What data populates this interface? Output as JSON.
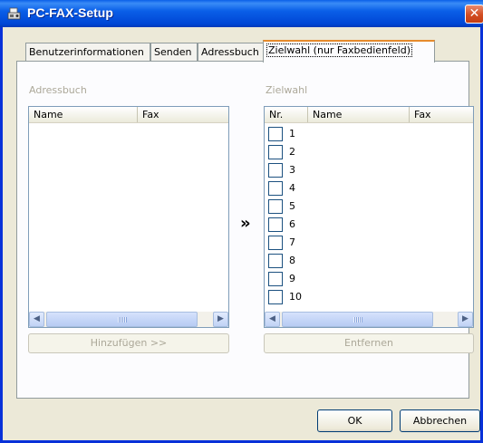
{
  "window": {
    "title": "PC-FAX-Setup",
    "close_glyph": "✕",
    "accent": "#0a5fe8",
    "close_color": "#d24d22"
  },
  "tabs": [
    {
      "label": "Benutzerinformationen",
      "active": false
    },
    {
      "label": "Senden",
      "active": false
    },
    {
      "label": "Adressbuch",
      "active": false
    },
    {
      "label": "Zielwahl (nur Faxbedienfeld)",
      "active": true
    }
  ],
  "addressbook": {
    "group_label": "Adressbuch",
    "columns": [
      "Name",
      "Fax"
    ],
    "add_button": "Hinzufügen >>"
  },
  "speeddial": {
    "group_label": "Zielwahl",
    "columns": [
      "Nr.",
      "Name",
      "Fax"
    ],
    "rows": [
      {
        "nr": "1"
      },
      {
        "nr": "2"
      },
      {
        "nr": "3"
      },
      {
        "nr": "4"
      },
      {
        "nr": "5"
      },
      {
        "nr": "6"
      },
      {
        "nr": "7"
      },
      {
        "nr": "8"
      },
      {
        "nr": "9"
      },
      {
        "nr": "10"
      }
    ],
    "remove_button": "Entfernen"
  },
  "transfer_glyph": "»",
  "footer": {
    "ok_label": "OK",
    "cancel_label": "Abbrechen"
  },
  "icons": {
    "scroll_left": "◀",
    "scroll_right": "▶",
    "app": "fax-setup-icon"
  }
}
